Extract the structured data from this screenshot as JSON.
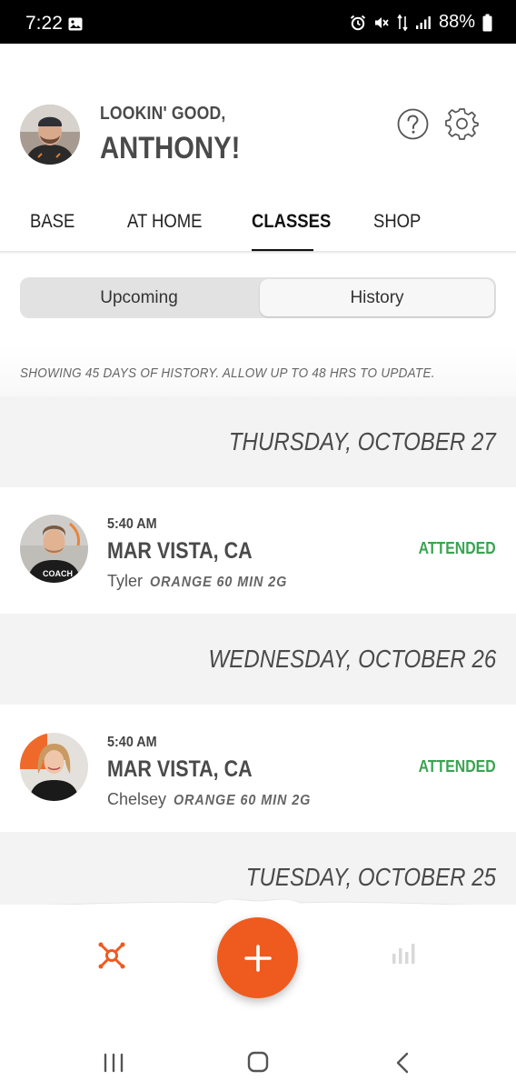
{
  "status_bar": {
    "time": "7:22",
    "battery": "88%"
  },
  "header": {
    "greeting_line1": "LOOKIN' GOOD,",
    "greeting_line2": "ANTHONY!"
  },
  "tabs": [
    {
      "label": "BASE",
      "active": false
    },
    {
      "label": "AT HOME",
      "active": false
    },
    {
      "label": "CLASSES",
      "active": true
    },
    {
      "label": "SHOP",
      "active": false
    }
  ],
  "segment": {
    "upcoming_label": "Upcoming",
    "history_label": "History",
    "selected": "History"
  },
  "info": {
    "text": "SHOWING 45 DAYS OF HISTORY. ALLOW UP TO 48 HRS TO UPDATE."
  },
  "history": [
    {
      "date": "THURSDAY, OCTOBER 27",
      "time": "5:40 AM",
      "location": "MAR VISTA, CA",
      "coach": "Tyler",
      "class_type": "ORANGE 60 MIN 2G",
      "status": "ATTENDED"
    },
    {
      "date": "WEDNESDAY, OCTOBER 26",
      "time": "5:40 AM",
      "location": "MAR VISTA, CA",
      "coach": "Chelsey",
      "class_type": "ORANGE 60 MIN 2G",
      "status": "ATTENDED"
    },
    {
      "date": "TUESDAY, OCTOBER 25"
    }
  ],
  "colors": {
    "accent": "#ef5a1e",
    "attended": "#3aa351"
  },
  "icons": {
    "help": "help-icon",
    "settings": "gear-icon",
    "home": "orangetheory-home-icon",
    "add": "plus-icon",
    "stats": "stats-icon"
  }
}
